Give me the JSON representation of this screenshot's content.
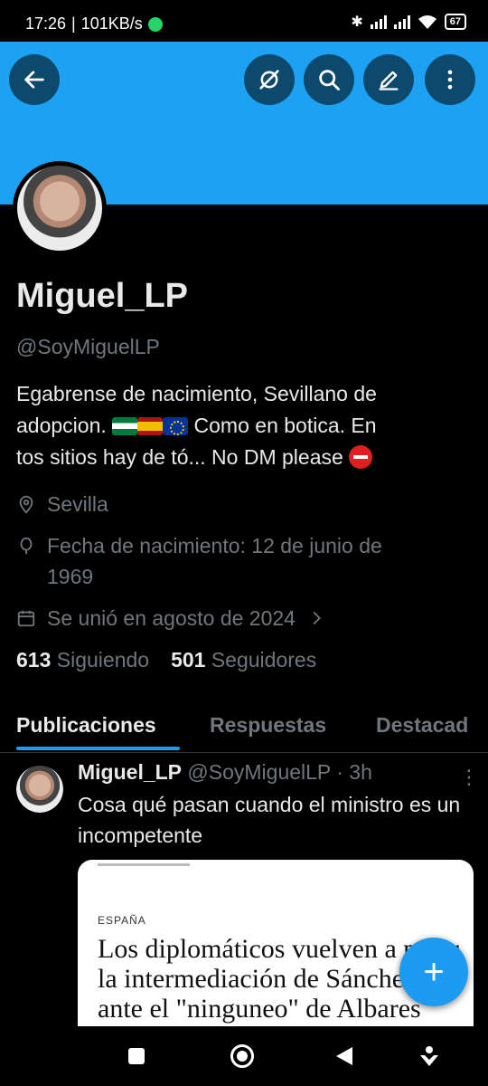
{
  "status_bar": {
    "time": "17:26",
    "speed": "101KB/s",
    "battery": "67"
  },
  "profile": {
    "name": "Miguel_LP",
    "handle": "@SoyMiguelLP",
    "bio_line1": "Egabrense de nacimiento, Sevillano de",
    "bio_line2a": "adopcion.",
    "bio_line2b": "Como en botica.  En",
    "bio_line3": "tos sitios hay de tó... No DM please",
    "location": "Sevilla",
    "birthdate_line1": "Fecha de nacimiento: 12 de junio de",
    "birthdate_line2": "1969",
    "joined": "Se unió en agosto de 2024",
    "following_count": "613",
    "following_label": "Siguiendo",
    "followers_count": "501",
    "followers_label": "Seguidores"
  },
  "tabs": [
    "Publicaciones",
    "Respuestas",
    "Destacad"
  ],
  "post": {
    "author": "Miguel_LP",
    "handle_time": "@SoyMiguelLP · 3h",
    "text": "Cosa qué pasan cuando el ministro es un incompetente",
    "card_kicker": "ESPAÑA",
    "card_title": "Los diplomáticos vuelven a pedir la intermediación de Sánchez ante el \"ninguneo\" de Albares"
  },
  "icons": {
    "back": "arrow-left-icon",
    "grok": "slash-circle-icon",
    "search": "search-icon",
    "edit": "pencil-icon",
    "more": "more-vertical-icon",
    "location": "location-pin-icon",
    "birthday": "balloon-icon",
    "calendar": "calendar-icon",
    "compose": "plus-icon"
  },
  "colors": {
    "banner": "#1da1f2",
    "accent": "#1d9bf0",
    "background": "#000000",
    "text_primary": "#e7e9ea",
    "text_secondary": "#71767b"
  }
}
